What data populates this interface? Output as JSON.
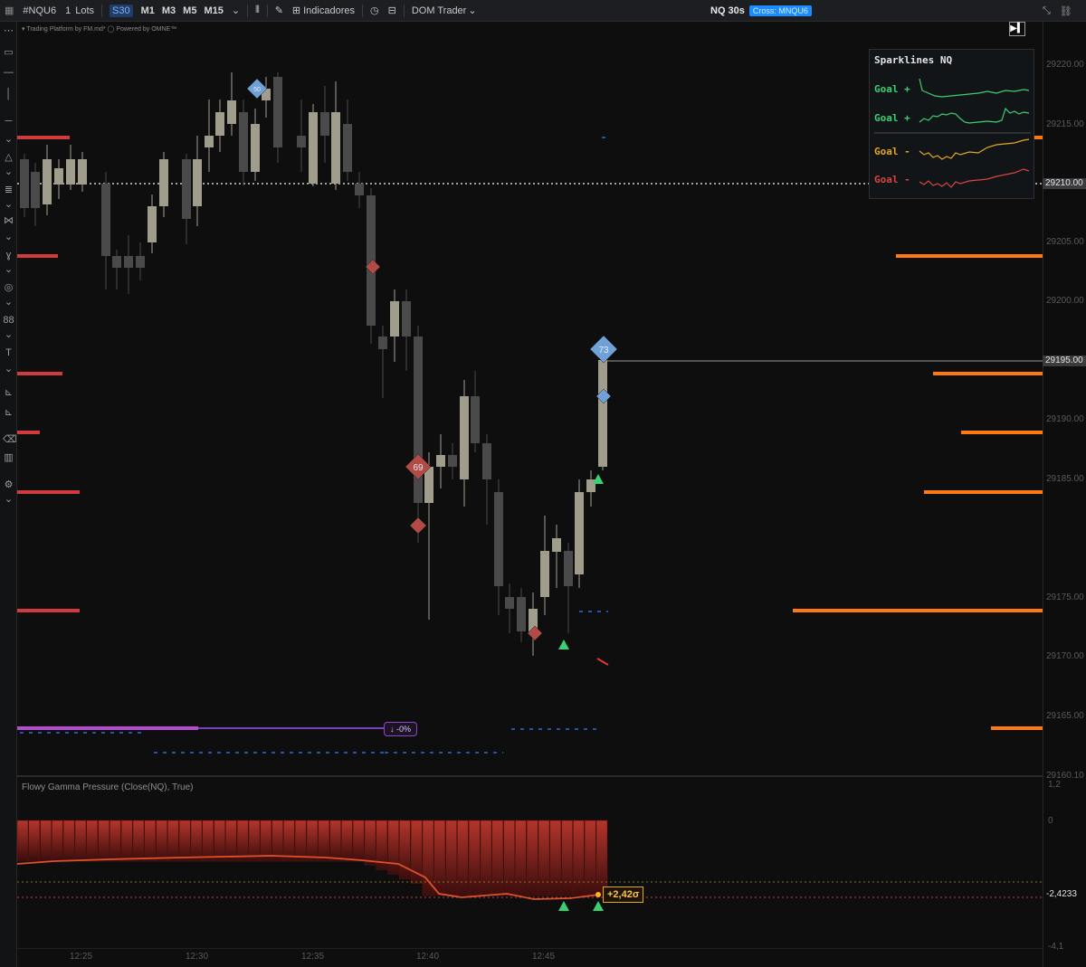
{
  "toolbar": {
    "symbol": "#NQU6",
    "lots": "1",
    "lots_label": "Lots",
    "timeframes": [
      "S30",
      "M1",
      "M3",
      "M5",
      "M15"
    ],
    "active_timeframe": "S30",
    "indicators_label": "Indicadores",
    "dom_trader_label": "DOM Trader",
    "chart_title": "NQ 30s",
    "cross_label": "Cross: MNQU6"
  },
  "chart": {
    "legend_text": "▾ Trading Platform by FM.md* ◯ Powered by OMNE™",
    "price_labels": [
      "29220.00",
      "29215.00",
      "29210.00",
      "29205.00",
      "29200.00",
      "29195.00",
      "29190.00",
      "29185.00",
      "29175.00",
      "29170.00",
      "29165.00",
      "29160.10"
    ],
    "current_price_tag": "29210.00",
    "level_price_tag": "29195.00",
    "time_labels": [
      "12:25",
      "12:30",
      "12:35",
      "12:40",
      "12:45"
    ],
    "markers": {
      "blue_diamond_top": "50",
      "blue_diamond_big": "73",
      "red_diamond_big": "69"
    },
    "purple_bar_label": "↓ -0%",
    "colors": {
      "candle_up": "#a19d8d",
      "candle_down": "#4a4a4a",
      "support": "#d13b3b",
      "resistance": "#ff7a10",
      "purple": "#b44cd0",
      "blue_marker": "#6fa0d8",
      "red_marker": "#b24a45",
      "green_marker": "#3ccf72"
    }
  },
  "sparklines": {
    "title": "Sparklines NQ",
    "rows": [
      {
        "label": "Goal +",
        "color": "#3ccf72"
      },
      {
        "label": "Goal +",
        "color": "#3ccf72"
      },
      {
        "label": "Goal -",
        "color": "#e6a71c"
      },
      {
        "label": "Goal -",
        "color": "#d84444"
      }
    ]
  },
  "subpanel": {
    "title": "Flowy Gamma Pressure (Close(NQ), True)",
    "value_tag": "+2,42σ",
    "axis_labels": [
      "1,2",
      "0",
      "-2,4233",
      "-4,1"
    ]
  }
}
